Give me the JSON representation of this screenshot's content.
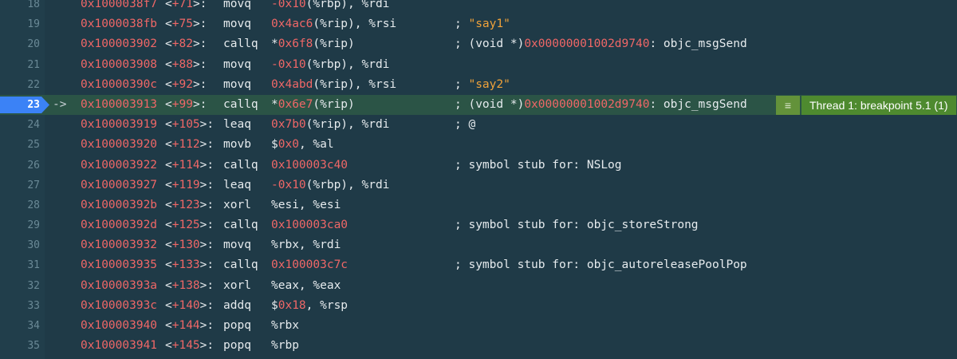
{
  "current_line": "23",
  "pc_marker": "->",
  "thread_indicator": {
    "icon": "lines-icon",
    "label": "Thread 1: breakpoint 5.1 (1)"
  },
  "colors": {
    "background": "#1f3a47",
    "current_line": "#2b5446",
    "breakpoint": "#3b82f6",
    "address": "#ef6767",
    "string": "#f0a23a",
    "badge": "#4e8a2f"
  },
  "lines": [
    {
      "ln": "18",
      "addr": "0x1000038f7",
      "off": "+71",
      "mn": "movq",
      "opd": [
        [
          "n",
          "-0x10"
        ],
        [
          "t",
          "(%rbp), %rdi"
        ]
      ],
      "cm": []
    },
    {
      "ln": "19",
      "addr": "0x1000038fb",
      "off": "+75",
      "mn": "movq",
      "opd": [
        [
          "n",
          "0x4ac6"
        ],
        [
          "t",
          "(%rip), %rsi"
        ]
      ],
      "cm": [
        [
          "t",
          "; "
        ],
        [
          "s",
          "\"say1\""
        ]
      ]
    },
    {
      "ln": "20",
      "addr": "0x100003902",
      "off": "+82",
      "mn": "callq",
      "opd": [
        [
          "t",
          "*"
        ],
        [
          "n",
          "0x6f8"
        ],
        [
          "t",
          "(%rip)"
        ]
      ],
      "cm": [
        [
          "t",
          "; (void *)"
        ],
        [
          "h",
          "0x00000001002d9740"
        ],
        [
          "t",
          ": objc_msgSend"
        ]
      ]
    },
    {
      "ln": "21",
      "addr": "0x100003908",
      "off": "+88",
      "mn": "movq",
      "opd": [
        [
          "n",
          "-0x10"
        ],
        [
          "t",
          "(%rbp), %rdi"
        ]
      ],
      "cm": []
    },
    {
      "ln": "22",
      "addr": "0x10000390c",
      "off": "+92",
      "mn": "movq",
      "opd": [
        [
          "n",
          "0x4abd"
        ],
        [
          "t",
          "(%rip), %rsi"
        ]
      ],
      "cm": [
        [
          "t",
          "; "
        ],
        [
          "s",
          "\"say2\""
        ]
      ]
    },
    {
      "ln": "23",
      "addr": "0x100003913",
      "off": "+99",
      "mn": "callq",
      "opd": [
        [
          "t",
          "*"
        ],
        [
          "n",
          "0x6e7"
        ],
        [
          "t",
          "(%rip)"
        ]
      ],
      "cm": [
        [
          "t",
          "; (void *)"
        ],
        [
          "h",
          "0x00000001002d9740"
        ],
        [
          "t",
          ": objc_msgSend"
        ]
      ]
    },
    {
      "ln": "24",
      "addr": "0x100003919",
      "off": "+105",
      "mn": "leaq",
      "opd": [
        [
          "n",
          "0x7b0"
        ],
        [
          "t",
          "(%rip), %rdi"
        ]
      ],
      "cm": [
        [
          "t",
          "; @"
        ]
      ]
    },
    {
      "ln": "25",
      "addr": "0x100003920",
      "off": "+112",
      "mn": "movb",
      "opd": [
        [
          "t",
          "$"
        ],
        [
          "n",
          "0x0"
        ],
        [
          "t",
          ", %al"
        ]
      ],
      "cm": []
    },
    {
      "ln": "26",
      "addr": "0x100003922",
      "off": "+114",
      "mn": "callq",
      "opd": [
        [
          "n",
          "0x100003c40"
        ]
      ],
      "cm": [
        [
          "t",
          "; symbol stub for: NSLog"
        ]
      ]
    },
    {
      "ln": "27",
      "addr": "0x100003927",
      "off": "+119",
      "mn": "leaq",
      "opd": [
        [
          "n",
          "-0x10"
        ],
        [
          "t",
          "(%rbp), %rdi"
        ]
      ],
      "cm": []
    },
    {
      "ln": "28",
      "addr": "0x10000392b",
      "off": "+123",
      "mn": "xorl",
      "opd": [
        [
          "t",
          "%esi, %esi"
        ]
      ],
      "cm": []
    },
    {
      "ln": "29",
      "addr": "0x10000392d",
      "off": "+125",
      "mn": "callq",
      "opd": [
        [
          "n",
          "0x100003ca0"
        ]
      ],
      "cm": [
        [
          "t",
          "; symbol stub for: objc_storeStrong"
        ]
      ]
    },
    {
      "ln": "30",
      "addr": "0x100003932",
      "off": "+130",
      "mn": "movq",
      "opd": [
        [
          "t",
          "%rbx, %rdi"
        ]
      ],
      "cm": []
    },
    {
      "ln": "31",
      "addr": "0x100003935",
      "off": "+133",
      "mn": "callq",
      "opd": [
        [
          "n",
          "0x100003c7c"
        ]
      ],
      "cm": [
        [
          "t",
          "; symbol stub for: objc_autoreleasePoolPop"
        ]
      ]
    },
    {
      "ln": "32",
      "addr": "0x10000393a",
      "off": "+138",
      "mn": "xorl",
      "opd": [
        [
          "t",
          "%eax, %eax"
        ]
      ],
      "cm": []
    },
    {
      "ln": "33",
      "addr": "0x10000393c",
      "off": "+140",
      "mn": "addq",
      "opd": [
        [
          "t",
          "$"
        ],
        [
          "n",
          "0x18"
        ],
        [
          "t",
          ", %rsp"
        ]
      ],
      "cm": []
    },
    {
      "ln": "34",
      "addr": "0x100003940",
      "off": "+144",
      "mn": "popq",
      "opd": [
        [
          "t",
          "%rbx"
        ]
      ],
      "cm": []
    },
    {
      "ln": "35",
      "addr": "0x100003941",
      "off": "+145",
      "mn": "popq",
      "opd": [
        [
          "t",
          "%rbp"
        ]
      ],
      "cm": []
    }
  ]
}
